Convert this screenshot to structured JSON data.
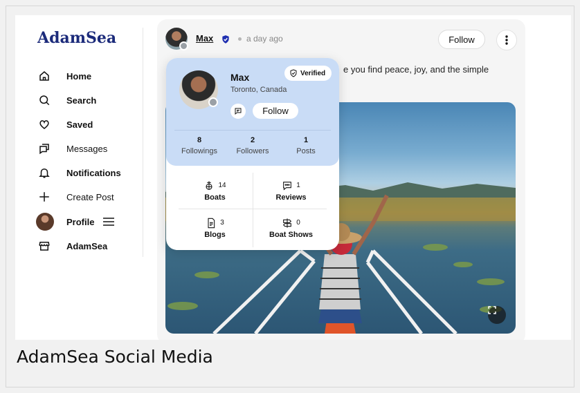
{
  "sidebar": {
    "logo": "AdamSea",
    "items": [
      {
        "label": "Home",
        "icon": "home-icon"
      },
      {
        "label": "Search",
        "icon": "search-icon"
      },
      {
        "label": "Saved",
        "icon": "heart-icon"
      },
      {
        "label": "Messages",
        "icon": "messages-icon"
      },
      {
        "label": "Notifications",
        "icon": "bell-icon"
      },
      {
        "label": "Create Post",
        "icon": "plus-icon"
      },
      {
        "label": "Profile",
        "icon": "menu-icon"
      },
      {
        "label": "AdamSea",
        "icon": "store-icon"
      }
    ]
  },
  "post": {
    "author": "Max",
    "time": "a day ago",
    "follow_label": "Follow",
    "text_visible": "e you find peace, joy, and the simple"
  },
  "profile_card": {
    "name": "Max",
    "location": "Toronto, Canada",
    "verified_label": "Verified",
    "follow_label": "Follow",
    "stats": [
      {
        "value": "8",
        "label": "Followings"
      },
      {
        "value": "2",
        "label": "Followers"
      },
      {
        "value": "1",
        "label": "Posts"
      }
    ],
    "grid": [
      {
        "count": "14",
        "label": "Boats",
        "icon": "boat-icon"
      },
      {
        "count": "1",
        "label": "Reviews",
        "icon": "reviews-icon"
      },
      {
        "count": "3",
        "label": "Blogs",
        "icon": "blog-icon"
      },
      {
        "count": "0",
        "label": "Boat Shows",
        "icon": "boat-show-icon"
      }
    ]
  },
  "caption": "AdamSea Social Media",
  "colors": {
    "logo": "#1b2a7a",
    "card_header": "#c9dcf6",
    "verified": "#1f2fb0"
  }
}
